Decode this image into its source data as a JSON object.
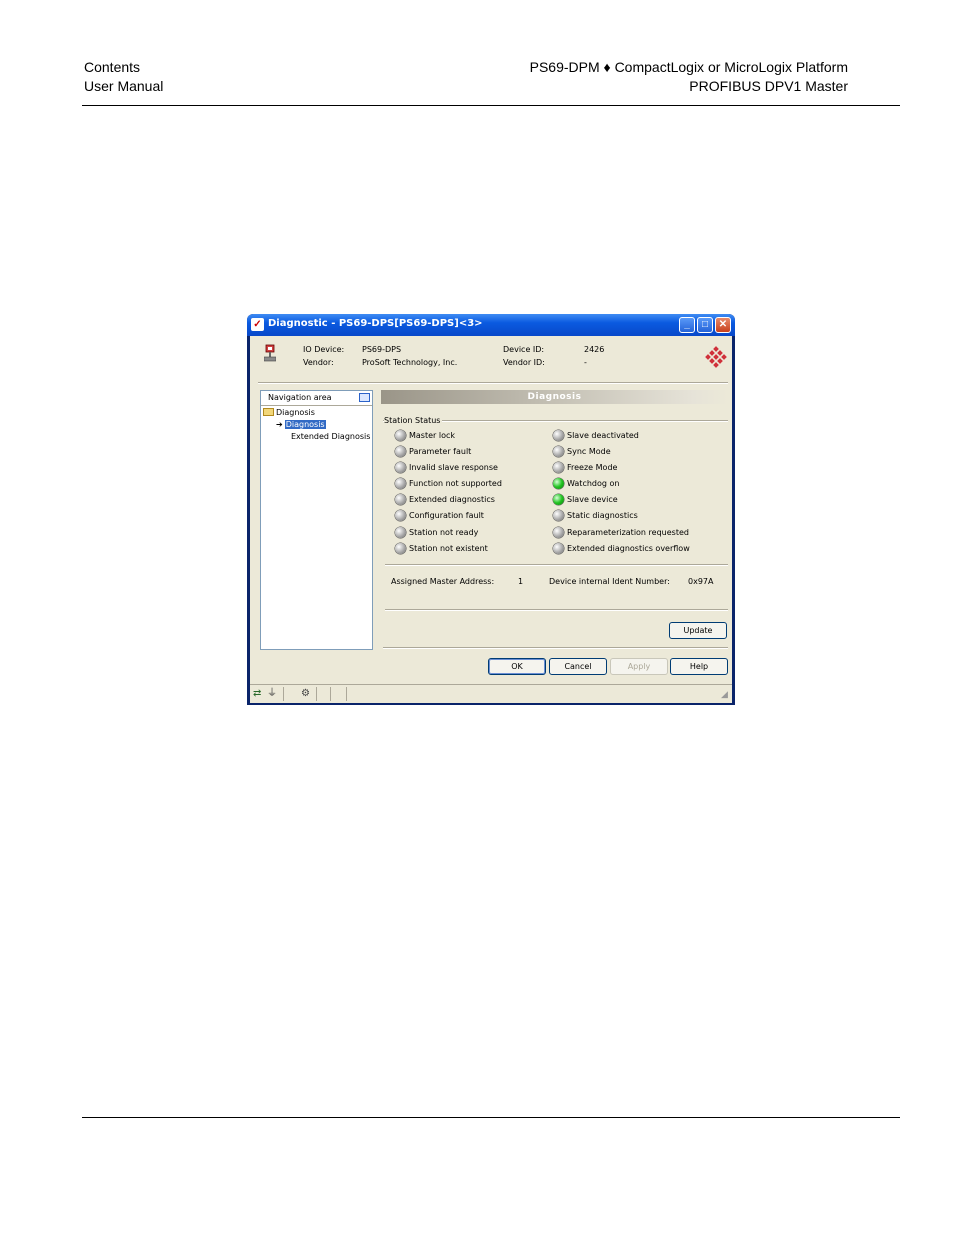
{
  "page_header": {
    "left_line1": "Contents",
    "left_line2": "User Manual",
    "right_line1": "PS69-DPM ♦ CompactLogix or MicroLogix Platform",
    "right_line2": "PROFIBUS DPV1 Master"
  },
  "window": {
    "title": "Diagnostic - PS69-DPS[PS69-DPS]<3>",
    "minimize_glyph": "_",
    "maximize_glyph": "□",
    "close_glyph": "✕"
  },
  "device": {
    "io_device_label": "IO Device:",
    "io_device_value": "PS69-DPS",
    "vendor_label": "Vendor:",
    "vendor_value": "ProSoft Technology, Inc.",
    "device_id_label": "Device ID:",
    "device_id_value": "2426",
    "vendor_id_label": "Vendor ID:",
    "vendor_id_value": "-"
  },
  "navigation": {
    "header": "Navigation area",
    "items": [
      {
        "label": "Diagnosis",
        "level": 0,
        "icon": "folder-open-icon"
      },
      {
        "label": "Diagnosis",
        "level": 1,
        "icon": "arrow-right-icon",
        "selected": true
      },
      {
        "label": "Extended Diagnosis",
        "level": 1
      }
    ]
  },
  "diagnosis": {
    "section_title": "Diagnosis",
    "group_label": "Station Status",
    "left_status": [
      {
        "label": "Master lock",
        "state": "off"
      },
      {
        "label": "Parameter fault",
        "state": "off"
      },
      {
        "label": "Invalid slave response",
        "state": "off"
      },
      {
        "label": "Function not supported",
        "state": "off"
      },
      {
        "label": "Extended diagnostics",
        "state": "off"
      },
      {
        "label": "Configuration fault",
        "state": "off"
      },
      {
        "label": "Station not ready",
        "state": "off"
      },
      {
        "label": "Station not existent",
        "state": "off"
      }
    ],
    "right_status": [
      {
        "label": "Slave deactivated",
        "state": "off"
      },
      {
        "label": "Sync Mode",
        "state": "off"
      },
      {
        "label": "Freeze Mode",
        "state": "off"
      },
      {
        "label": "Watchdog on",
        "state": "on"
      },
      {
        "label": "Slave device",
        "state": "on"
      },
      {
        "label": "Static diagnostics",
        "state": "off"
      },
      {
        "label": "Reparameterization requested",
        "state": "off"
      },
      {
        "label": "Extended diagnostics overflow",
        "state": "off"
      }
    ],
    "assigned_master_label": "Assigned Master Address:",
    "assigned_master_value": "1",
    "ident_label": "Device internal Ident Number:",
    "ident_value": "0x97A",
    "update_button": "Update"
  },
  "dialog_buttons": {
    "ok": "OK",
    "cancel": "Cancel",
    "apply": "Apply",
    "help": "Help"
  },
  "colors": {
    "led_on": "#22c422",
    "led_off": "#a8a8a8",
    "selection": "#316ac5"
  }
}
